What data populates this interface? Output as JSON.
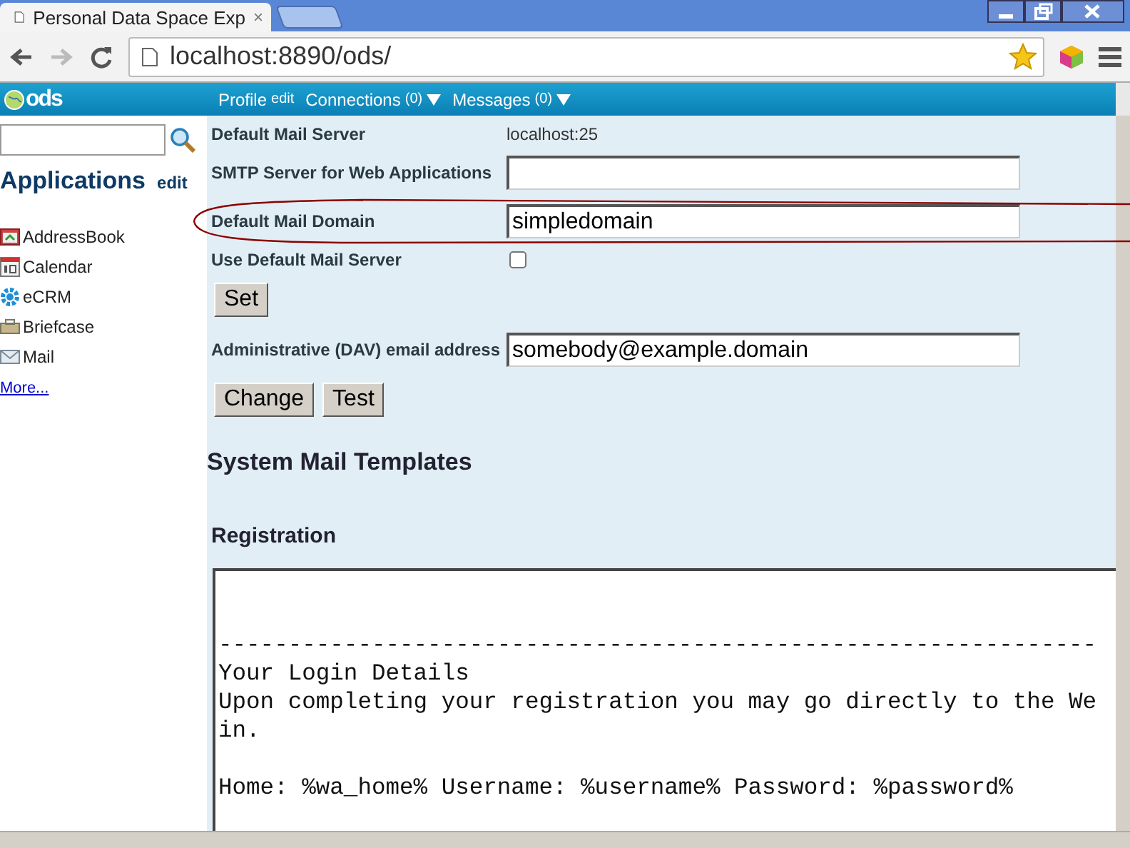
{
  "browser": {
    "tab_title": "Personal Data Space Exp",
    "url": "localhost:8890/ods/"
  },
  "nav": {
    "logo": "ods",
    "items": [
      {
        "label": "Profile",
        "extra": "edit",
        "dropdown": false
      },
      {
        "label": "Connections",
        "extra": "(0)",
        "dropdown": true
      },
      {
        "label": "Messages",
        "extra": "(0)",
        "dropdown": true
      }
    ]
  },
  "sidebar": {
    "heading": "Applications",
    "heading_link": "edit",
    "items": [
      {
        "label": "AddressBook"
      },
      {
        "label": "Calendar"
      },
      {
        "label": "eCRM"
      },
      {
        "label": "Briefcase"
      },
      {
        "label": "Mail"
      }
    ],
    "more": "More..."
  },
  "form": {
    "rows": [
      {
        "kind": "text",
        "label": "Default Mail Server",
        "value": "localhost:25"
      },
      {
        "kind": "input",
        "label": "SMTP Server for Web Applications",
        "value": ""
      },
      {
        "kind": "input",
        "label": "Default Mail Domain",
        "value": "simpledomain"
      },
      {
        "kind": "checkbox",
        "label": "Use Default Mail Server",
        "checked": false
      },
      {
        "kind": "buttons",
        "buttons": [
          "Set"
        ]
      },
      {
        "kind": "input",
        "label": "Administrative (DAV) email address",
        "value": "somebody@example.domain"
      },
      {
        "kind": "buttons",
        "buttons": [
          "Change",
          "Test"
        ]
      }
    ]
  },
  "templates": {
    "heading": "System Mail Templates",
    "subheading": "Registration",
    "lines": [
      [
        "---------------------------------------------------------------",
        "Your Login Details",
        "Upon completing your registration you may go directly to the We",
        "in."
      ],
      [
        "Home: %wa_home% Username: %username% Password: %password%"
      ]
    ]
  }
}
